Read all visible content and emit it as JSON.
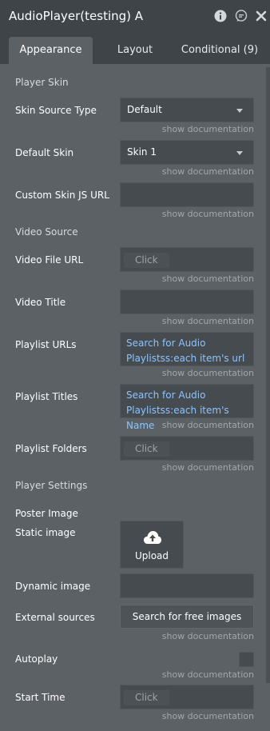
{
  "window": {
    "title": "AudioPlayer(testing) A"
  },
  "tabs": [
    "Appearance",
    "Layout",
    "Conditional (9)"
  ],
  "doc_link": "show documentation",
  "sections": {
    "player_skin": "Player Skin",
    "video_source": "Video Source",
    "player_settings": "Player Settings"
  },
  "fields": {
    "skin_source_type": {
      "label": "Skin Source Type",
      "value": "Default"
    },
    "default_skin": {
      "label": "Default Skin",
      "value": "Skin 1"
    },
    "custom_skin_js_url": {
      "label": "Custom Skin JS URL",
      "value": ""
    },
    "video_file_url": {
      "label": "Video File URL",
      "placeholder": "Click"
    },
    "video_title": {
      "label": "Video Title",
      "value": ""
    },
    "playlist_urls": {
      "label": "Playlist URLs",
      "value": "Search for Audio Playlistss:each item's url"
    },
    "playlist_titles": {
      "label": "Playlist Titles",
      "value": "Search for Audio Playlistss:each item's Name"
    },
    "playlist_folders": {
      "label": "Playlist Folders",
      "placeholder": "Click"
    },
    "poster_image": {
      "label": "Poster Image"
    },
    "static_image": {
      "label": "Static image",
      "button": "Upload"
    },
    "dynamic_image": {
      "label": "Dynamic image",
      "value": ""
    },
    "external_sources": {
      "label": "External sources",
      "button": "Search for free images"
    },
    "autoplay": {
      "label": "Autoplay",
      "checked": false
    },
    "start_time": {
      "label": "Start Time",
      "placeholder": "Click"
    }
  },
  "colors": {
    "panel": "#5c6166",
    "header": "#3f4449",
    "input": "#464b50",
    "dynamic_text": "#8cc4ff"
  }
}
